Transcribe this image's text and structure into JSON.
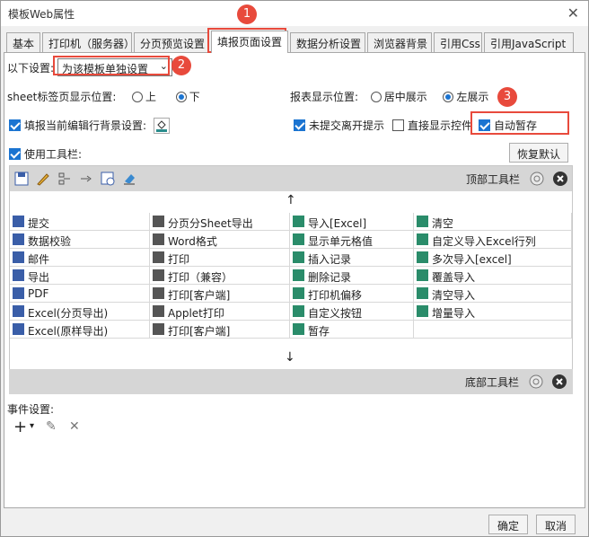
{
  "window": {
    "title": "模板Web属性",
    "close": "✕"
  },
  "tabs": [
    {
      "label": "基本"
    },
    {
      "label": "打印机（服务器）"
    },
    {
      "label": "分页预览设置"
    },
    {
      "label": "填报页面设置"
    },
    {
      "label": "数据分析设置"
    },
    {
      "label": "浏览器背景"
    },
    {
      "label": "引用Css"
    },
    {
      "label": "引用JavaScript"
    }
  ],
  "settings": {
    "scope_label": "以下设置:",
    "scope_value": "为该模板单独设置",
    "sheet_pos_label": "sheet标签页显示位置:",
    "sheet_top": "上",
    "sheet_bottom": "下",
    "report_pos_label": "报表显示位置:",
    "report_center": "居中展示",
    "report_left": "左展示",
    "fill_bg_label": "填报当前编辑行背景设置:",
    "unsubmitted": "未提交离开提示",
    "direct_show": "直接显示控件",
    "auto_save": "自动暂存",
    "use_toolbar": "使用工具栏:",
    "restore_default": "恢复默认"
  },
  "toolbar": {
    "top_label": "顶部工具栏",
    "bottom_label": "底部工具栏",
    "up_arrow": "↑",
    "down_arrow": "↓",
    "items": [
      [
        "提交",
        "分页分Sheet导出",
        "导入[Excel]",
        "清空"
      ],
      [
        "数据校验",
        "Word格式",
        "显示单元格值",
        "自定义导入Excel行列"
      ],
      [
        "邮件",
        "打印",
        "插入记录",
        "多次导入[excel]"
      ],
      [
        "导出",
        "打印（兼容）",
        "删除记录",
        "覆盖导入"
      ],
      [
        "PDF",
        "打印[客户端]",
        "打印机偏移",
        "清空导入"
      ],
      [
        "Excel(分页导出)",
        "Applet打印",
        "自定义按钮",
        "增量导入"
      ],
      [
        "Excel(原样导出)",
        "打印[客户端]",
        "暂存",
        ""
      ]
    ]
  },
  "events": {
    "label": "事件设置:",
    "add": "+",
    "add_caret": "▾",
    "edit": "✎",
    "delete": "✕"
  },
  "footer": {
    "ok": "确定",
    "cancel": "取消"
  },
  "marks": [
    "1",
    "2",
    "3"
  ],
  "colors": {
    "accent": "#1b74d1",
    "annotation": "#e84a3c"
  }
}
